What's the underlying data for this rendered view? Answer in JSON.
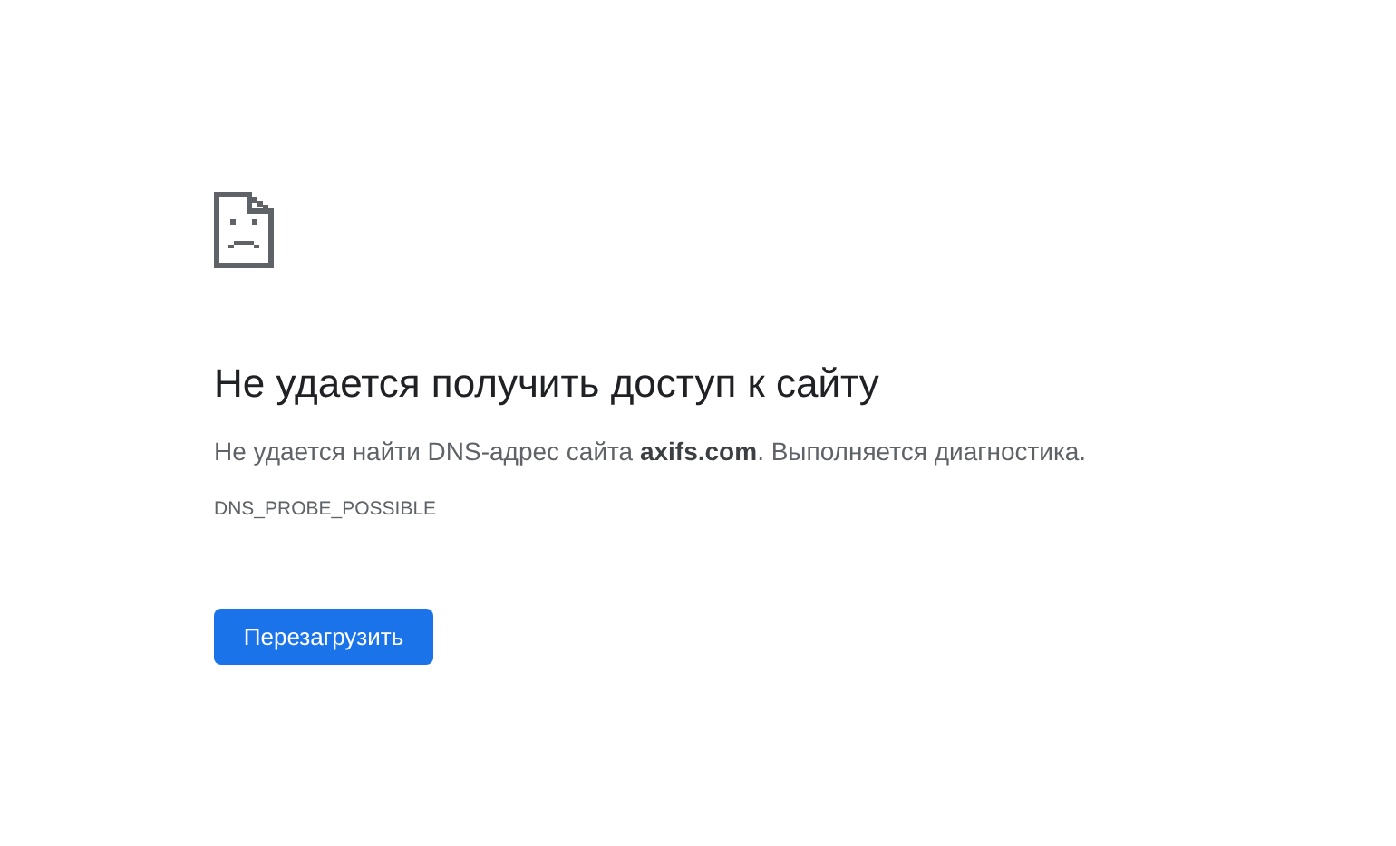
{
  "title": "Не удается получить доступ к сайту",
  "message": "Не удается найти DNS-адрес сайта **axifs.com**. Выполняется диагностика.",
  "error_code": "DNS_PROBE_POSSIBLE",
  "buttons": [
    {
      "label": "Перезагрузить"
    }
  ]
}
